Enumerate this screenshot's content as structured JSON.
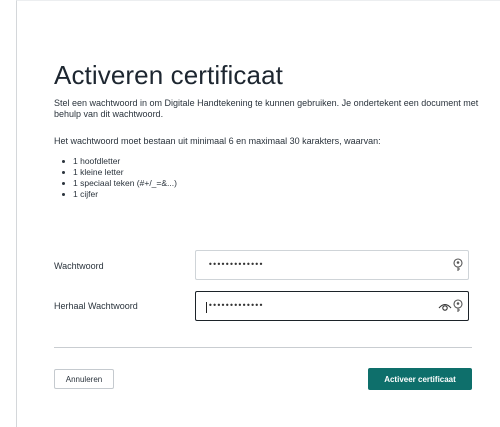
{
  "dialog": {
    "title": "Activeren certificaat",
    "intro": "Stel een wachtwoord in om Digitale Handtekening te kunnen gebruiken. Je ondertekent een document met behulp van dit wachtwoord.",
    "rules_intro": "Het wachtwoord moet bestaan uit minimaal 6 en maximaal 30 karakters, waarvan:",
    "requirements": [
      "1 hoofdletter",
      "1 kleine letter",
      "1 speciaal teken (#+/_=&...)",
      "1 cijfer"
    ]
  },
  "form": {
    "password": {
      "label": "Wachtwoord",
      "value": "•••••••••••••"
    },
    "repeat_password": {
      "label": "Herhaal Wachtwoord",
      "value": "•••••••••••••"
    }
  },
  "actions": {
    "cancel_label": "Annuleren",
    "activate_label": "Activeer certificaat"
  },
  "colors": {
    "primary_button": "#0e6f6b",
    "text": "#1f2a33",
    "border": "#cfd4d8"
  },
  "icons": {
    "password_field": [
      "key-icon"
    ],
    "repeat_field": [
      "eye-icon",
      "key-icon"
    ]
  }
}
